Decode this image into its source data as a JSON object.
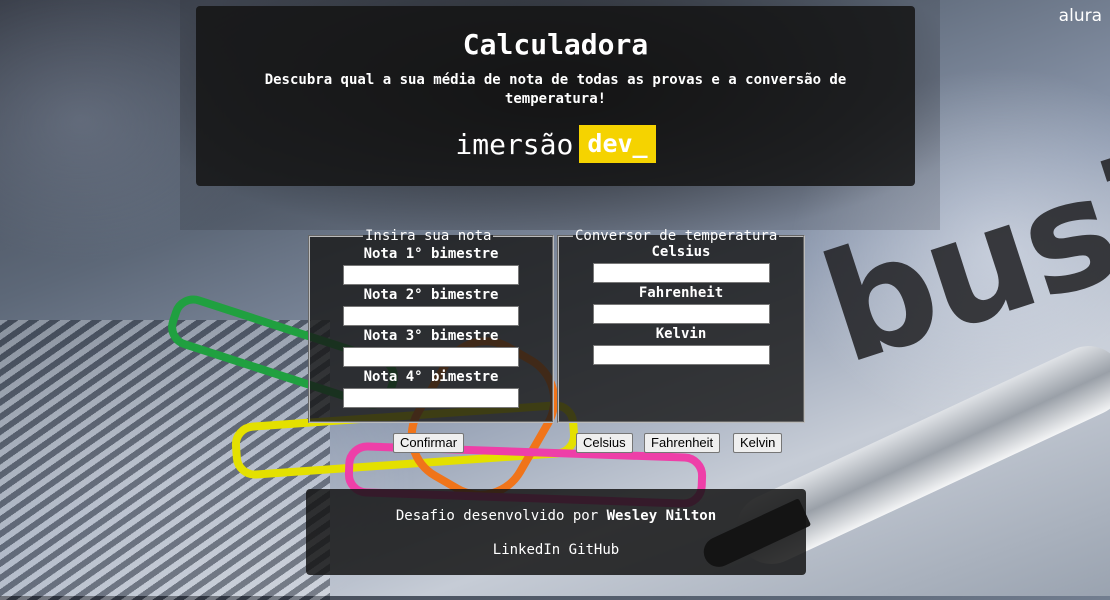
{
  "brand": {
    "text": "alura"
  },
  "header": {
    "title": "Calculadora",
    "subtitle": "Descubra qual a sua média de nota de todas as provas e a conversão de temperatura!",
    "logo_word": "imersão",
    "logo_dev": "dev_"
  },
  "notas": {
    "legend": "Insira sua nota",
    "fields": [
      {
        "label": "Nota 1° bimestre",
        "value": ""
      },
      {
        "label": "Nota 2° bimestre",
        "value": ""
      },
      {
        "label": "Nota 3° bimestre",
        "value": ""
      },
      {
        "label": "Nota 4° bimestre",
        "value": ""
      }
    ],
    "confirm_label": "Confirmar"
  },
  "temperatura": {
    "legend": "Conversor de temperatura",
    "fields": [
      {
        "label": "Celsius",
        "value": ""
      },
      {
        "label": "Fahrenheit",
        "value": ""
      },
      {
        "label": "Kelvin",
        "value": ""
      }
    ],
    "buttons": [
      "Celsius",
      "Fahrenheit",
      "Kelvin"
    ]
  },
  "footer": {
    "credit_prefix": "Desafio desenvolvido por",
    "author": "Wesley Nilton",
    "links": [
      "LinkedIn",
      "GitHub"
    ]
  },
  "colors": {
    "accent": "#f5d300",
    "panel": "#141414"
  }
}
